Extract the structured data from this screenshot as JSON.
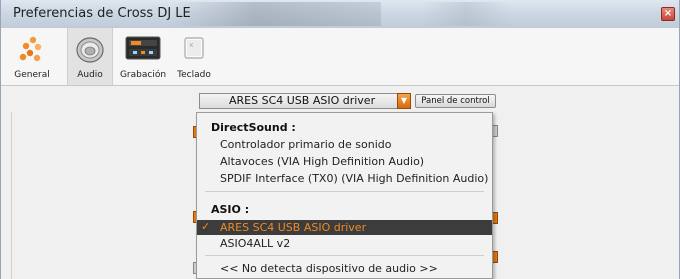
{
  "window": {
    "title": "Preferencias de Cross DJ LE",
    "close_label": "×"
  },
  "toolbar": {
    "items": [
      {
        "label": "General",
        "icon": "general-icon"
      },
      {
        "label": "Audio",
        "icon": "speaker-icon"
      },
      {
        "label": "Grabación",
        "icon": "recording-icon"
      },
      {
        "label": "Teclado",
        "icon": "keyboard-icon"
      }
    ],
    "selected": "Audio"
  },
  "audio": {
    "driver_value": "ARES SC4 USB ASIO driver",
    "panel_button": "Panel de control"
  },
  "dropdown": {
    "groups": [
      {
        "header": "DirectSound :",
        "items": [
          "Controlador primario de sonido",
          "Altavoces (VIA High Definition Audio)",
          "SPDIF Interface (TX0) (VIA High Definition Audio)"
        ]
      },
      {
        "header": "ASIO :",
        "items": [
          "ARES SC4 USB ASIO driver",
          "ASIO4ALL v2"
        ]
      }
    ],
    "selected_item": "ARES SC4 USB ASIO driver",
    "check_mark": "✓",
    "no_device": "<< No detecta dispositivo de audio >>"
  },
  "colors": {
    "accent": "#f08a24",
    "highlight_bg": "#3c3c3c"
  }
}
